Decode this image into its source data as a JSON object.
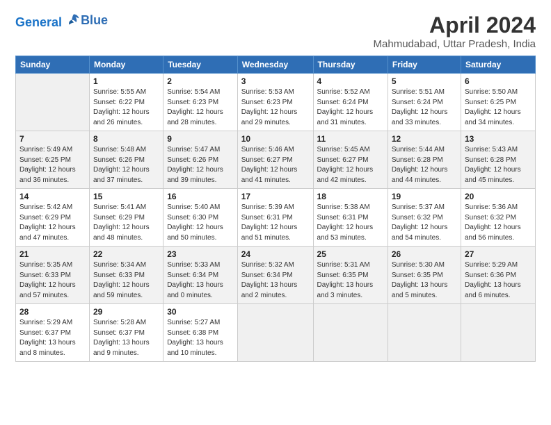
{
  "header": {
    "logo_line1": "General",
    "logo_line2": "Blue",
    "month": "April 2024",
    "location": "Mahmudabad, Uttar Pradesh, India"
  },
  "weekdays": [
    "Sunday",
    "Monday",
    "Tuesday",
    "Wednesday",
    "Thursday",
    "Friday",
    "Saturday"
  ],
  "weeks": [
    [
      {
        "num": "",
        "detail": ""
      },
      {
        "num": "1",
        "detail": "Sunrise: 5:55 AM\nSunset: 6:22 PM\nDaylight: 12 hours\nand 26 minutes."
      },
      {
        "num": "2",
        "detail": "Sunrise: 5:54 AM\nSunset: 6:23 PM\nDaylight: 12 hours\nand 28 minutes."
      },
      {
        "num": "3",
        "detail": "Sunrise: 5:53 AM\nSunset: 6:23 PM\nDaylight: 12 hours\nand 29 minutes."
      },
      {
        "num": "4",
        "detail": "Sunrise: 5:52 AM\nSunset: 6:24 PM\nDaylight: 12 hours\nand 31 minutes."
      },
      {
        "num": "5",
        "detail": "Sunrise: 5:51 AM\nSunset: 6:24 PM\nDaylight: 12 hours\nand 33 minutes."
      },
      {
        "num": "6",
        "detail": "Sunrise: 5:50 AM\nSunset: 6:25 PM\nDaylight: 12 hours\nand 34 minutes."
      }
    ],
    [
      {
        "num": "7",
        "detail": "Sunrise: 5:49 AM\nSunset: 6:25 PM\nDaylight: 12 hours\nand 36 minutes."
      },
      {
        "num": "8",
        "detail": "Sunrise: 5:48 AM\nSunset: 6:26 PM\nDaylight: 12 hours\nand 37 minutes."
      },
      {
        "num": "9",
        "detail": "Sunrise: 5:47 AM\nSunset: 6:26 PM\nDaylight: 12 hours\nand 39 minutes."
      },
      {
        "num": "10",
        "detail": "Sunrise: 5:46 AM\nSunset: 6:27 PM\nDaylight: 12 hours\nand 41 minutes."
      },
      {
        "num": "11",
        "detail": "Sunrise: 5:45 AM\nSunset: 6:27 PM\nDaylight: 12 hours\nand 42 minutes."
      },
      {
        "num": "12",
        "detail": "Sunrise: 5:44 AM\nSunset: 6:28 PM\nDaylight: 12 hours\nand 44 minutes."
      },
      {
        "num": "13",
        "detail": "Sunrise: 5:43 AM\nSunset: 6:28 PM\nDaylight: 12 hours\nand 45 minutes."
      }
    ],
    [
      {
        "num": "14",
        "detail": "Sunrise: 5:42 AM\nSunset: 6:29 PM\nDaylight: 12 hours\nand 47 minutes."
      },
      {
        "num": "15",
        "detail": "Sunrise: 5:41 AM\nSunset: 6:29 PM\nDaylight: 12 hours\nand 48 minutes."
      },
      {
        "num": "16",
        "detail": "Sunrise: 5:40 AM\nSunset: 6:30 PM\nDaylight: 12 hours\nand 50 minutes."
      },
      {
        "num": "17",
        "detail": "Sunrise: 5:39 AM\nSunset: 6:31 PM\nDaylight: 12 hours\nand 51 minutes."
      },
      {
        "num": "18",
        "detail": "Sunrise: 5:38 AM\nSunset: 6:31 PM\nDaylight: 12 hours\nand 53 minutes."
      },
      {
        "num": "19",
        "detail": "Sunrise: 5:37 AM\nSunset: 6:32 PM\nDaylight: 12 hours\nand 54 minutes."
      },
      {
        "num": "20",
        "detail": "Sunrise: 5:36 AM\nSunset: 6:32 PM\nDaylight: 12 hours\nand 56 minutes."
      }
    ],
    [
      {
        "num": "21",
        "detail": "Sunrise: 5:35 AM\nSunset: 6:33 PM\nDaylight: 12 hours\nand 57 minutes."
      },
      {
        "num": "22",
        "detail": "Sunrise: 5:34 AM\nSunset: 6:33 PM\nDaylight: 12 hours\nand 59 minutes."
      },
      {
        "num": "23",
        "detail": "Sunrise: 5:33 AM\nSunset: 6:34 PM\nDaylight: 13 hours\nand 0 minutes."
      },
      {
        "num": "24",
        "detail": "Sunrise: 5:32 AM\nSunset: 6:34 PM\nDaylight: 13 hours\nand 2 minutes."
      },
      {
        "num": "25",
        "detail": "Sunrise: 5:31 AM\nSunset: 6:35 PM\nDaylight: 13 hours\nand 3 minutes."
      },
      {
        "num": "26",
        "detail": "Sunrise: 5:30 AM\nSunset: 6:35 PM\nDaylight: 13 hours\nand 5 minutes."
      },
      {
        "num": "27",
        "detail": "Sunrise: 5:29 AM\nSunset: 6:36 PM\nDaylight: 13 hours\nand 6 minutes."
      }
    ],
    [
      {
        "num": "28",
        "detail": "Sunrise: 5:29 AM\nSunset: 6:37 PM\nDaylight: 13 hours\nand 8 minutes."
      },
      {
        "num": "29",
        "detail": "Sunrise: 5:28 AM\nSunset: 6:37 PM\nDaylight: 13 hours\nand 9 minutes."
      },
      {
        "num": "30",
        "detail": "Sunrise: 5:27 AM\nSunset: 6:38 PM\nDaylight: 13 hours\nand 10 minutes."
      },
      {
        "num": "",
        "detail": ""
      },
      {
        "num": "",
        "detail": ""
      },
      {
        "num": "",
        "detail": ""
      },
      {
        "num": "",
        "detail": ""
      }
    ]
  ]
}
